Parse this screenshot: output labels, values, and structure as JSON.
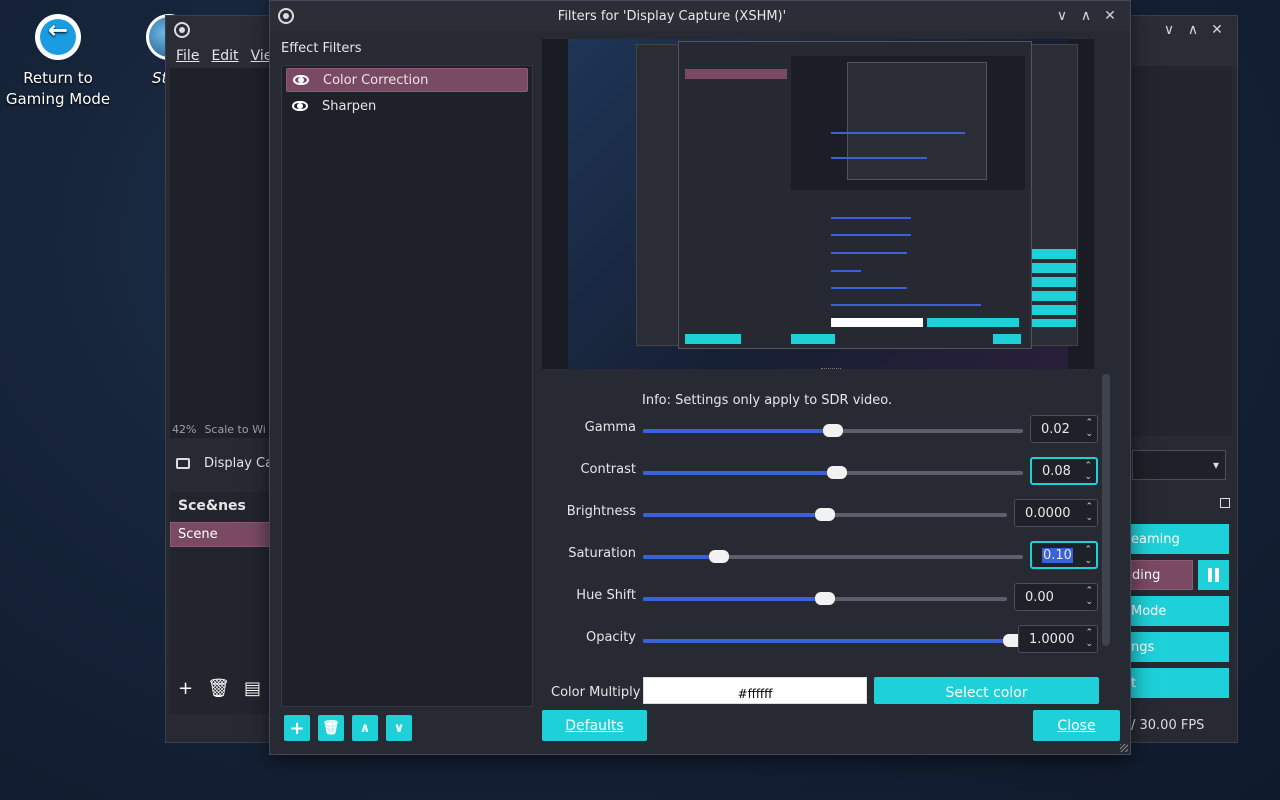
{
  "desktop": {
    "return_label_line1": "Return to",
    "return_label_line2": "Gaming Mode",
    "steam_label": "St"
  },
  "obs_main": {
    "menu": [
      "File",
      "Edit",
      "View"
    ],
    "zoom": "42%",
    "scale_label": "Scale to Wi",
    "source_label": "Display Cap",
    "scenes_title": "Sce&nes",
    "scene_item": "Scene",
    "side_buttons": [
      "eaming",
      "ding",
      "Mode",
      "ngs",
      "t"
    ],
    "fps": "/ 30.00 FPS"
  },
  "dialog": {
    "title": "Filters for 'Display Capture (XSHM)'",
    "effect_filters_label": "Effect Filters",
    "filters": [
      "Color Correction",
      "Sharpen"
    ],
    "info": "Info: Settings only apply to SDR video.",
    "rows": [
      {
        "label": "Gamma",
        "value": "0.02",
        "level": 0.5
      },
      {
        "label": "Contrast",
        "value": "0.08",
        "level": 0.51
      },
      {
        "label": "Brightness",
        "value": "0.0000",
        "level": 0.5
      },
      {
        "label": "Saturation",
        "value": "0.10",
        "level": 0.2
      },
      {
        "label": "Hue Shift",
        "value": "0.00",
        "level": 0.5
      },
      {
        "label": "Opacity",
        "value": "1.0000",
        "level": 1.0
      }
    ],
    "color_multiply_label": "Color Multiply",
    "color_multiply_value": "#ffffff",
    "select_color_label": "Select color",
    "defaults_label": "Defaults",
    "close_label": "Close"
  },
  "colors": {
    "accent": "#1ed0d8",
    "selection": "#7a4a63",
    "slider_fill": "#3a62d8"
  }
}
